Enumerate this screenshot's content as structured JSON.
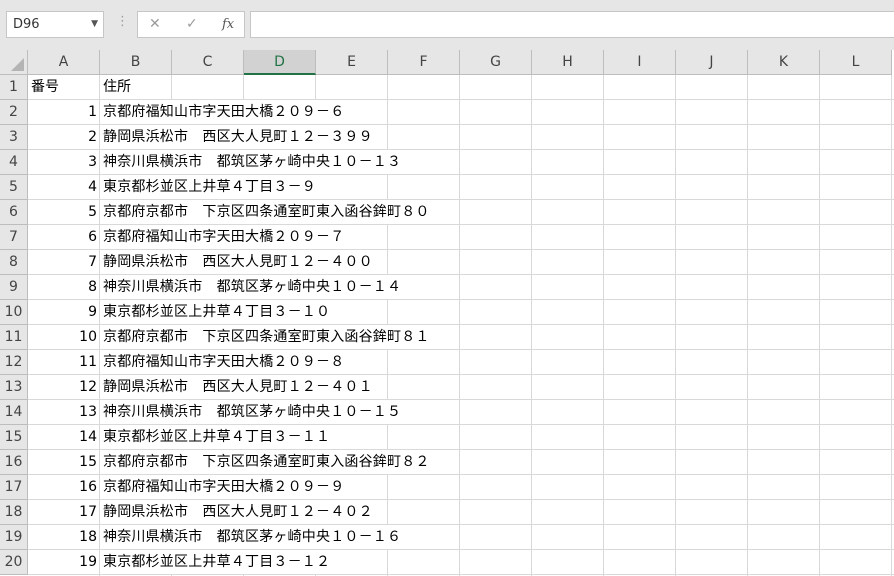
{
  "name_box": "D96",
  "formula_icons": [
    "cancel-icon",
    "enter-icon",
    "function-icon"
  ],
  "fx_label": "fx",
  "columns": [
    "A",
    "B",
    "C",
    "D",
    "E",
    "F",
    "G",
    "H",
    "I",
    "J",
    "K",
    "L"
  ],
  "active_column": "D",
  "row_numbers": [
    "1",
    "2",
    "3",
    "4",
    "5",
    "6",
    "7",
    "8",
    "9",
    "10",
    "11",
    "12",
    "13",
    "14",
    "15",
    "16",
    "17",
    "18",
    "19",
    "20"
  ],
  "header": {
    "number": "番号",
    "address": "住所"
  },
  "rows": [
    {
      "n": "1",
      "addr": "京都府福知山市字天田大橋２０９－６"
    },
    {
      "n": "2",
      "addr": "静岡県浜松市　西区大人見町１２－３９９"
    },
    {
      "n": "3",
      "addr": "神奈川県横浜市　都筑区茅ヶ崎中央１０－１３"
    },
    {
      "n": "4",
      "addr": "東京都杉並区上井草４丁目３－９"
    },
    {
      "n": "5",
      "addr": "京都府京都市　下京区四条通室町東入函谷鉾町８０"
    },
    {
      "n": "6",
      "addr": "京都府福知山市字天田大橋２０９－７"
    },
    {
      "n": "7",
      "addr": "静岡県浜松市　西区大人見町１２－４００"
    },
    {
      "n": "8",
      "addr": "神奈川県横浜市　都筑区茅ヶ崎中央１０－１４"
    },
    {
      "n": "9",
      "addr": "東京都杉並区上井草４丁目３－１０"
    },
    {
      "n": "10",
      "addr": "京都府京都市　下京区四条通室町東入函谷鉾町８１"
    },
    {
      "n": "11",
      "addr": "京都府福知山市字天田大橋２０９－８"
    },
    {
      "n": "12",
      "addr": "静岡県浜松市　西区大人見町１２－４０１"
    },
    {
      "n": "13",
      "addr": "神奈川県横浜市　都筑区茅ヶ崎中央１０－１５"
    },
    {
      "n": "14",
      "addr": "東京都杉並区上井草４丁目３－１１"
    },
    {
      "n": "15",
      "addr": "京都府京都市　下京区四条通室町東入函谷鉾町８２"
    },
    {
      "n": "16",
      "addr": "京都府福知山市字天田大橋２０９－９"
    },
    {
      "n": "17",
      "addr": "静岡県浜松市　西区大人見町１２－４０２"
    },
    {
      "n": "18",
      "addr": "神奈川県横浜市　都筑区茅ヶ崎中央１０－１６"
    },
    {
      "n": "19",
      "addr": "東京都杉並区上井草４丁目３－１２"
    }
  ],
  "colors": {
    "accent": "#217346",
    "header_bg": "#e6e6e6",
    "gridline": "#d9d9d9"
  }
}
